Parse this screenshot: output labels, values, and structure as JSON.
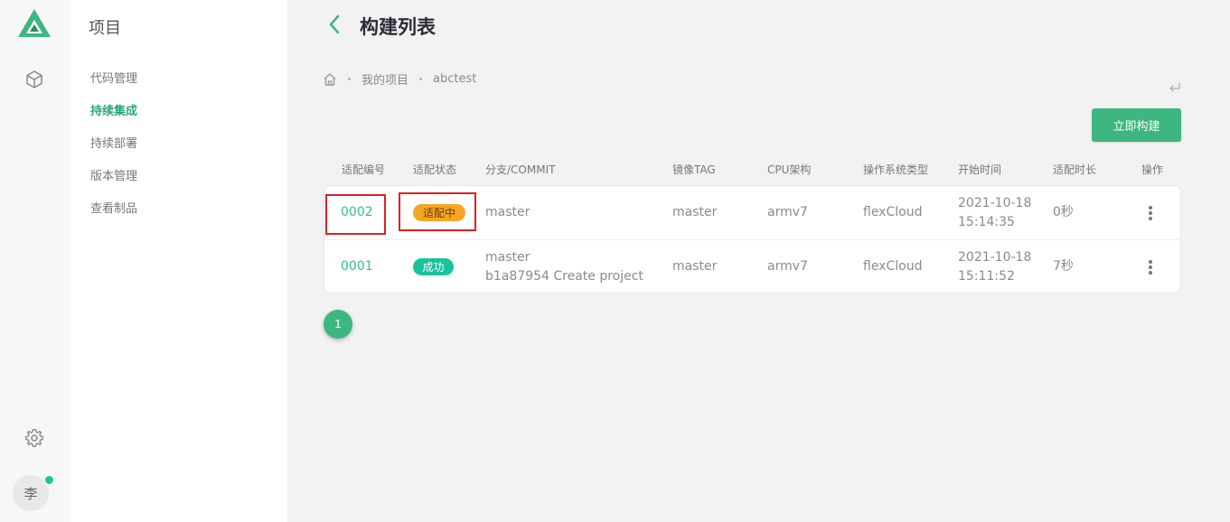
{
  "rail": {
    "avatar_text": "李"
  },
  "sidenav": {
    "title": "项目",
    "items": [
      {
        "label": "代码管理"
      },
      {
        "label": "持续集成"
      },
      {
        "label": "持续部署"
      },
      {
        "label": "版本管理"
      },
      {
        "label": "查看制品"
      }
    ],
    "active_index": 1
  },
  "header": {
    "title": "构建列表"
  },
  "breadcrumb": {
    "items": [
      "我的项目",
      "abctest"
    ]
  },
  "actions": {
    "build_label": "立即构建"
  },
  "table": {
    "columns": [
      "适配编号",
      "适配状态",
      "分支/COMMIT",
      "镜像TAG",
      "CPU架构",
      "操作系统类型",
      "开始时间",
      "适配时长",
      "操作"
    ],
    "rows": [
      {
        "id": "0002",
        "status": "适配中",
        "branch": "master",
        "commit": "",
        "tag": "master",
        "cpu": "armv7",
        "os": "flexCloud",
        "start_date": "2021-10-18",
        "start_time": "15:14:35",
        "duration": "0秒"
      },
      {
        "id": "0001",
        "status": "成功",
        "branch": "master",
        "commit": "b1a87954 Create project",
        "tag": "master",
        "cpu": "armv7",
        "os": "flexCloud",
        "start_date": "2021-10-18",
        "start_time": "15:11:52",
        "duration": "7秒"
      }
    ]
  },
  "pagination": {
    "current": "1"
  },
  "colors": {
    "accent": "#3eb680",
    "running": "#f5a623",
    "success": "#19c3a0",
    "highlight": "#e02020"
  }
}
